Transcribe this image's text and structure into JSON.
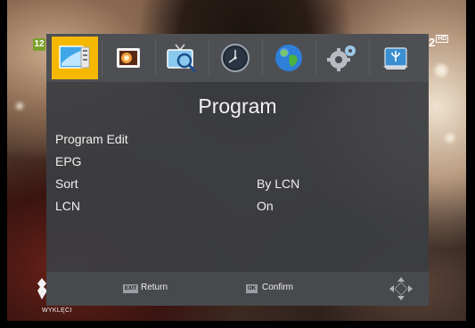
{
  "channel": {
    "left_number": "12",
    "right_number": "2",
    "right_badge": "HD"
  },
  "watermark": {
    "text": "WYKLĘCI"
  },
  "tabs": [
    {
      "name": "program",
      "icon": "program-edit-icon",
      "active": true
    },
    {
      "name": "picture",
      "icon": "picture-icon",
      "active": false
    },
    {
      "name": "channel-search",
      "icon": "channel-search-icon",
      "active": false
    },
    {
      "name": "time",
      "icon": "clock-icon",
      "active": false
    },
    {
      "name": "option",
      "icon": "globe-icon",
      "active": false
    },
    {
      "name": "system",
      "icon": "gear-icon",
      "active": false
    },
    {
      "name": "usb",
      "icon": "usb-icon",
      "active": false
    }
  ],
  "menu": {
    "title": "Program",
    "items": [
      {
        "label": "Program Edit",
        "value": ""
      },
      {
        "label": "EPG",
        "value": ""
      },
      {
        "label": "Sort",
        "value": "By LCN"
      },
      {
        "label": "LCN",
        "value": "On"
      }
    ]
  },
  "footer": {
    "exit_key": "EXIT",
    "exit_label": "Return",
    "ok_key": "OK",
    "ok_label": "Confirm"
  },
  "colors": {
    "active_tab": "#f5b800",
    "panel": "#3c3e42"
  }
}
